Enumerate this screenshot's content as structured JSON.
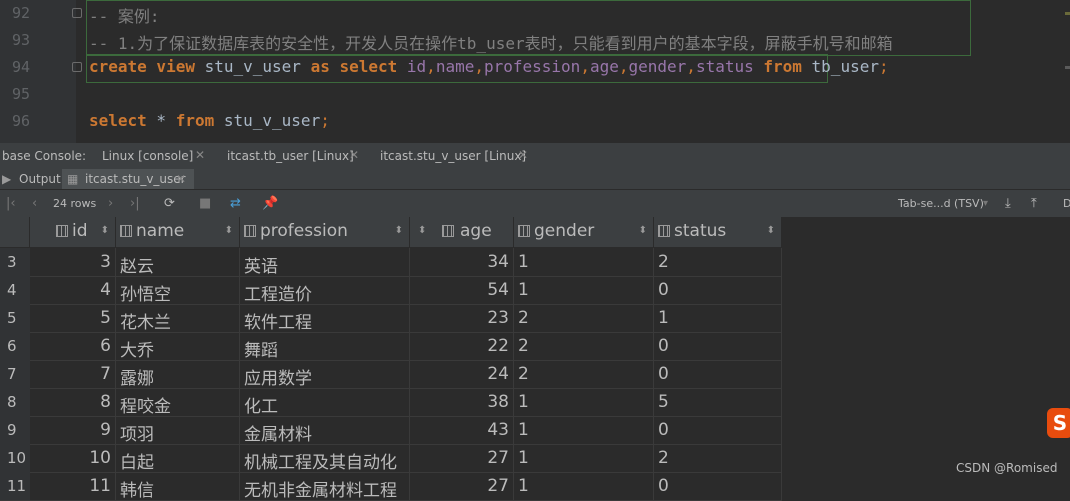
{
  "editor": {
    "lines": [
      {
        "num": "92",
        "text": "-- 案例:"
      },
      {
        "num": "93",
        "text": "-- 1.为了保证数据库表的安全性，开发人员在操作tb_user表时，只能看到用户的基本字段，屏蔽手机号和邮箱"
      },
      {
        "num": "94",
        "kw1": "create view",
        "view_name": " stu_v_user ",
        "kw2": "as select",
        "fields": [
          "id",
          "name",
          "profession",
          "age",
          "gender",
          "status"
        ],
        "kw3": " from",
        "table": " tb_user",
        "end": ";"
      },
      {
        "num": "95"
      },
      {
        "num": "96",
        "kw1": "select",
        "star": " * ",
        "kw2": "from",
        "table": " stu_v_user",
        "end": ";"
      }
    ]
  },
  "console_tabs": {
    "label": "base Console:",
    "tabs": [
      "Linux [console]",
      "itcast.tb_user [Linux]",
      "itcast.stu_v_user [Linux]"
    ]
  },
  "result_tabs": {
    "output": "Output",
    "active": "itcast.stu_v_user"
  },
  "toolbar": {
    "rows": "24 rows",
    "format": "Tab-se...d (TSV)"
  },
  "table": {
    "columns": [
      "id",
      "name",
      "profession",
      "age",
      "gender",
      "status"
    ],
    "rows": [
      {
        "rn": "3",
        "id": "3",
        "name": "赵云",
        "profession": "英语",
        "age": "34",
        "gender": "1",
        "status": "2"
      },
      {
        "rn": "4",
        "id": "4",
        "name": "孙悟空",
        "profession": "工程造价",
        "age": "54",
        "gender": "1",
        "status": "0"
      },
      {
        "rn": "5",
        "id": "5",
        "name": "花木兰",
        "profession": "软件工程",
        "age": "23",
        "gender": "2",
        "status": "1"
      },
      {
        "rn": "6",
        "id": "6",
        "name": "大乔",
        "profession": "舞蹈",
        "age": "22",
        "gender": "2",
        "status": "0"
      },
      {
        "rn": "7",
        "id": "7",
        "name": "露娜",
        "profession": "应用数学",
        "age": "24",
        "gender": "2",
        "status": "0"
      },
      {
        "rn": "8",
        "id": "8",
        "name": "程咬金",
        "profession": "化工",
        "age": "38",
        "gender": "1",
        "status": "5"
      },
      {
        "rn": "9",
        "id": "9",
        "name": "项羽",
        "profession": "金属材料",
        "age": "43",
        "gender": "1",
        "status": "0"
      },
      {
        "rn": "10",
        "id": "10",
        "name": "白起",
        "profession": "机械工程及其自动化",
        "age": "27",
        "gender": "1",
        "status": "2"
      },
      {
        "rn": "11",
        "id": "11",
        "name": "韩信",
        "profession": "无机非金属材料工程",
        "age": "27",
        "gender": "1",
        "status": "0"
      }
    ]
  },
  "watermark": "CSDN @Romised"
}
